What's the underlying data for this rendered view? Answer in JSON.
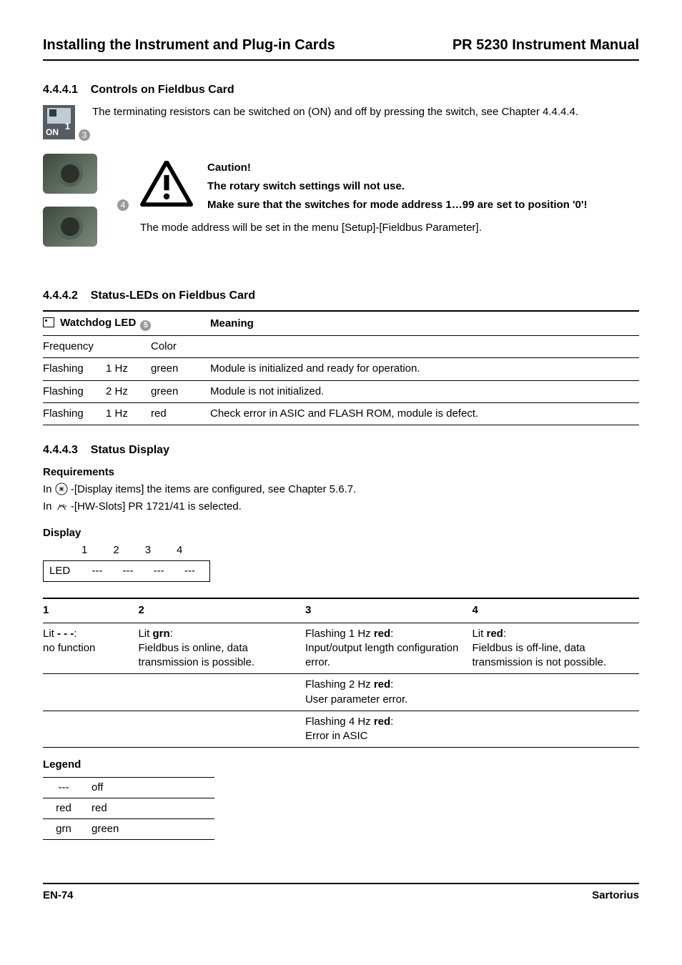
{
  "header": {
    "left": "Installing the Instrument and Plug-in Cards",
    "right": "PR 5230 Instrument Manual"
  },
  "s441": {
    "num": "4.4.4.1",
    "title": "Controls on Fieldbus Card",
    "p1": "The terminating resistors can be switched on (ON) and off by pressing the switch, see Chapter 4.4.4.4.",
    "caution_title": "Caution!",
    "caution_l1": "The rotary switch settings will not use.",
    "caution_l2": "Make sure that the switches for mode address 1…99 are set to position '0'!",
    "p2": "The mode address will be set in the menu [Setup]-[Fieldbus Parameter].",
    "callout3": "3",
    "callout4": "4"
  },
  "s442": {
    "num": "4.4.4.2",
    "title": "Status-LEDs on Fieldbus Card",
    "hdr1": "Watchdog LED",
    "hdr1_callout": "5",
    "hdr2": "Meaning",
    "sub1": "Frequency",
    "sub2": "Color",
    "rows": [
      {
        "a": "Flashing",
        "b": "1 Hz",
        "c": "green",
        "d": "Module is initialized and ready for operation."
      },
      {
        "a": "Flashing",
        "b": "2 Hz",
        "c": "green",
        "d": "Module is not initialized."
      },
      {
        "a": "Flashing",
        "b": "1 Hz",
        "c": "red",
        "d": "Check error in ASIC and FLASH ROM, module is defect."
      }
    ]
  },
  "s443": {
    "num": "4.4.4.3",
    "title": "Status Display",
    "req_h": "Requirements",
    "req1a": "In ",
    "req1b": "-[Display items] the items are configured, see Chapter 5.6.7.",
    "req2a": "In ",
    "req2b": "-[HW-Slots] PR 1721/41 is selected.",
    "disp_h": "Display",
    "led_label": "LED",
    "led_dash": "---",
    "hdr": [
      "1",
      "2",
      "3",
      "4"
    ],
    "tbl": {
      "c1": "Lit - - -:\nno function",
      "c2": "Lit grn:\nFieldbus is online, data transmission is possible.",
      "c3a": "Flashing 1 Hz red:\nInput/output length configuration error.",
      "c3b": "Flashing 2 Hz red:\nUser parameter error.",
      "c3c": "Flashing 4 Hz red:\nError in ASIC",
      "c4": "Lit red:\nFieldbus is off-line, data transmission is not possible."
    },
    "legend_h": "Legend",
    "legend": [
      {
        "a": "---",
        "b": "off"
      },
      {
        "a": "red",
        "b": "red"
      },
      {
        "a": "grn",
        "b": "green"
      }
    ]
  },
  "footer": {
    "left": "EN-74",
    "right": "Sartorius"
  }
}
